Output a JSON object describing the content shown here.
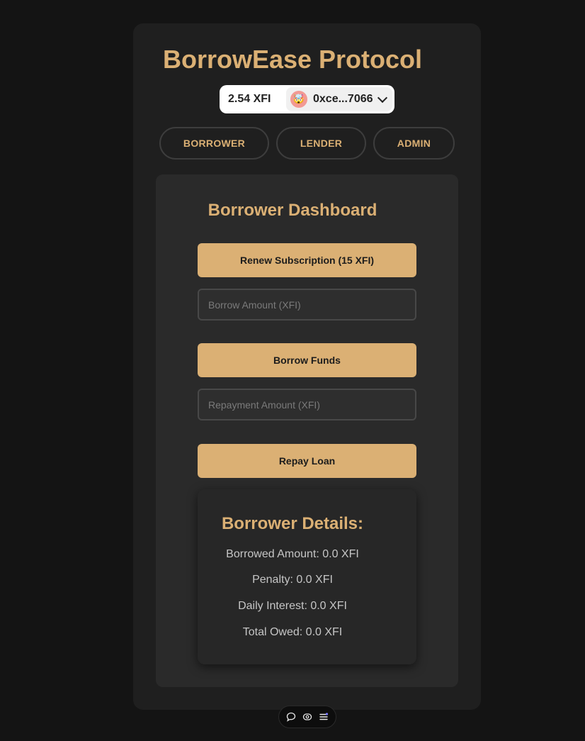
{
  "app": {
    "title": "BorrowEase Protocol"
  },
  "wallet": {
    "balance": "2.54 XFI",
    "address": "0xce...7066",
    "avatar_emoji": "🤯"
  },
  "tabs": [
    {
      "label": "BORROWER"
    },
    {
      "label": "LENDER"
    },
    {
      "label": "ADMIN"
    }
  ],
  "dashboard": {
    "title": "Borrower Dashboard",
    "renew_label": "Renew Subscription (15 XFI)",
    "borrow_placeholder": "Borrow Amount (XFI)",
    "borrow_label": "Borrow Funds",
    "repay_placeholder": "Repayment Amount (XFI)",
    "repay_label": "Repay Loan"
  },
  "details": {
    "title": "Borrower Details:",
    "lines": [
      "Borrowed Amount: 0.0 XFI",
      "Penalty: 0.0 XFI",
      "Daily Interest: 0.0 XFI",
      "Total Owed: 0.0 XFI"
    ]
  },
  "toolbar": {
    "icons": [
      "chat-icon",
      "inspect-icon",
      "menu-icon"
    ]
  },
  "colors": {
    "accent": "#dbb074",
    "background": "#141414",
    "card": "#1f1f1f",
    "panel": "#2a2a2a"
  }
}
